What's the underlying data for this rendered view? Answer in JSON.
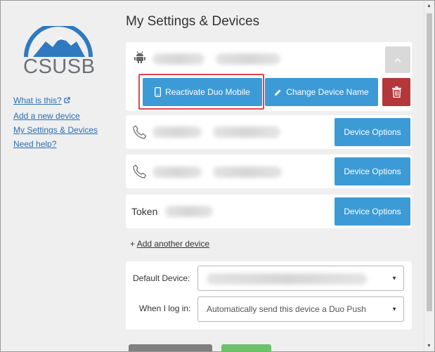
{
  "page": {
    "title": "My Settings & Devices"
  },
  "logo": {
    "text": "CSUSB",
    "brand_color": "#2f79c0"
  },
  "sidebar": {
    "links": [
      {
        "label": "What is this?",
        "icon": "external-link-icon"
      },
      {
        "label": "Add a new device"
      },
      {
        "label": "My Settings & Devices"
      },
      {
        "label": "Need help?"
      }
    ]
  },
  "devices": {
    "android": {
      "icon": "android-icon",
      "collapse_icon": "chevron-up-icon",
      "reactivate_label": "Reactivate Duo Mobile",
      "change_name_label": "Change Device Name",
      "delete_icon": "trash-icon"
    },
    "phone1": {
      "icon": "phone-icon",
      "options_label": "Device Options"
    },
    "phone2": {
      "icon": "phone-icon",
      "options_label": "Device Options"
    },
    "token": {
      "label": "Token",
      "options_label": "Device Options"
    }
  },
  "add_device": {
    "prefix": "+ ",
    "label": "Add another device"
  },
  "settings": {
    "default_device_label": "Default Device:",
    "login_label": "When I log in:",
    "login_value": "Automatically send this device a Duo Push"
  },
  "colors": {
    "primary": "#3c9bd6",
    "danger": "#b4373a",
    "highlight": "#e0474c"
  }
}
